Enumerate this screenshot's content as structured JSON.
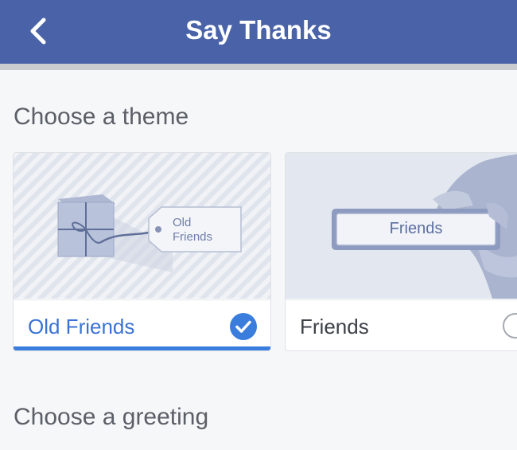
{
  "header": {
    "title": "Say Thanks",
    "back_icon": "chevron-left-icon"
  },
  "sections": {
    "theme_heading": "Choose a theme",
    "greeting_heading": "Choose a greeting"
  },
  "themes": [
    {
      "label": "Old Friends",
      "image_tag_line1": "Old",
      "image_tag_line2": "Friends",
      "selected": true,
      "icon": "check-circle-icon"
    },
    {
      "label": "Friends",
      "image_plate_text": "Friends",
      "selected": false,
      "icon": "radio-unchecked-icon"
    }
  ],
  "colors": {
    "header": "#4a63a8",
    "accent": "#3b7ddd",
    "selected_label": "#3a73d6"
  }
}
